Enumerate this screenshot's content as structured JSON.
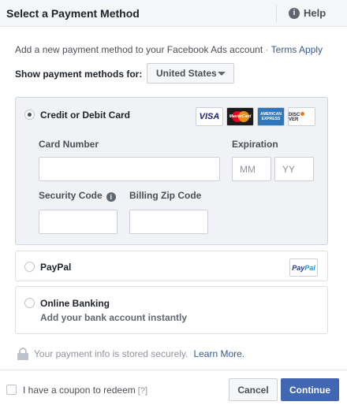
{
  "header": {
    "title": "Select a Payment Method",
    "help_label": "Help",
    "help_icon": "info-circle-icon"
  },
  "intro": {
    "text": "Add a new payment method to your Facebook Ads account",
    "separator": "·",
    "terms_link": "Terms Apply"
  },
  "show_methods": {
    "label": "Show payment methods for:",
    "country": "United States"
  },
  "options": {
    "card": {
      "label": "Credit or Debit Card",
      "selected": true,
      "brands": {
        "visa": "VISA",
        "mastercard": "MasterCard",
        "amex_1": "AMERICAN",
        "amex_2": "EXPRESS",
        "discover_1": "DISC",
        "discover_2": "VER"
      },
      "card_number_label": "Card Number",
      "card_number_value": "",
      "expiration_label": "Expiration",
      "month_placeholder": "MM",
      "year_placeholder": "YY",
      "security_code_label": "Security Code",
      "zip_label": "Billing Zip Code"
    },
    "paypal": {
      "label": "PayPal",
      "logo_1": "Pay",
      "logo_2": "Pal",
      "selected": false
    },
    "banking": {
      "label": "Online Banking",
      "sub": "Add your bank account instantly",
      "selected": false
    }
  },
  "secure": {
    "text": "Your payment info is stored securely.",
    "link": "Learn More."
  },
  "footer": {
    "coupon_label": "I have a coupon to redeem",
    "coupon_help": "[?]",
    "cancel": "Cancel",
    "continue": "Continue"
  },
  "colors": {
    "accent": "#4267b2",
    "link": "#365899",
    "selected_bg": "#f0f2f5"
  }
}
